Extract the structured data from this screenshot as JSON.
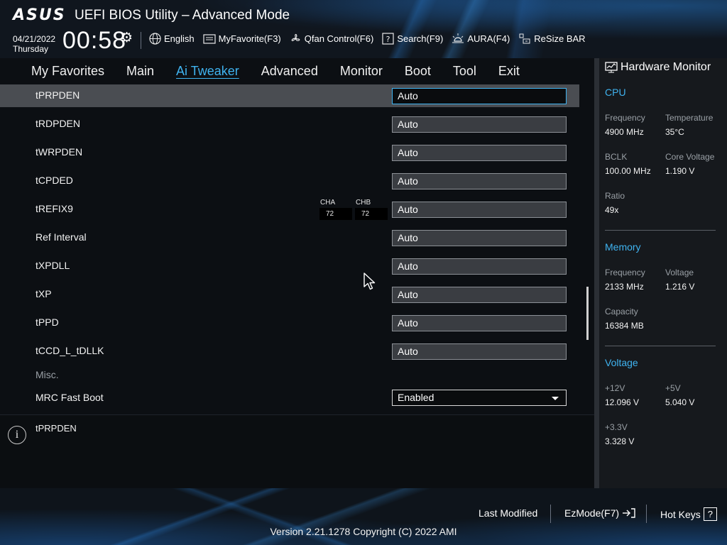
{
  "header": {
    "logo": "ASUS",
    "title": "UEFI BIOS Utility – Advanced Mode",
    "date": "04/21/2022",
    "day": "Thursday",
    "time": "00:58",
    "toolbar": [
      {
        "label": "English",
        "icon": "globe-icon"
      },
      {
        "label": "MyFavorite(F3)",
        "icon": "favorite-icon"
      },
      {
        "label": "Qfan Control(F6)",
        "icon": "fan-icon"
      },
      {
        "label": "Search(F9)",
        "icon": "search-icon"
      },
      {
        "label": "AURA(F4)",
        "icon": "aura-icon"
      },
      {
        "label": "ReSize BAR",
        "icon": "resize-bar-icon"
      }
    ]
  },
  "nav": {
    "tabs": [
      "My Favorites",
      "Main",
      "Ai Tweaker",
      "Advanced",
      "Monitor",
      "Boot",
      "Tool",
      "Exit"
    ],
    "active": "Ai Tweaker"
  },
  "settings": {
    "rows": [
      {
        "label": "tPRPDEN",
        "value": "Auto"
      },
      {
        "label": "tRDPDEN",
        "value": "Auto"
      },
      {
        "label": "tWRPDEN",
        "value": "Auto"
      },
      {
        "label": "tCPDED",
        "value": "Auto"
      },
      {
        "label": "tREFIX9",
        "value": "Auto"
      },
      {
        "label": "Ref Interval",
        "value": "Auto"
      },
      {
        "label": "tXPDLL",
        "value": "Auto"
      },
      {
        "label": "tXP",
        "value": "Auto"
      },
      {
        "label": "tPPD",
        "value": "Auto"
      },
      {
        "label": "tCCD_L_tDLLK",
        "value": "Auto"
      }
    ],
    "channels": [
      {
        "name": "CHA",
        "value": "72"
      },
      {
        "name": "CHB",
        "value": "72"
      }
    ],
    "section": "Misc.",
    "mrc_fast_boot": {
      "label": "MRC Fast Boot",
      "value": "Enabled"
    }
  },
  "help": {
    "text": "tPRPDEN"
  },
  "hardware_monitor": {
    "title": "Hardware Monitor",
    "cpu": {
      "title": "CPU",
      "frequency_label": "Frequency",
      "frequency": "4900 MHz",
      "temperature_label": "Temperature",
      "temperature": "35°C",
      "bclk_label": "BCLK",
      "bclk": "100.00 MHz",
      "core_voltage_label": "Core Voltage",
      "core_voltage": "1.190 V",
      "ratio_label": "Ratio",
      "ratio": "49x"
    },
    "memory": {
      "title": "Memory",
      "frequency_label": "Frequency",
      "frequency": "2133 MHz",
      "voltage_label": "Voltage",
      "voltage": "1.216 V",
      "capacity_label": "Capacity",
      "capacity": "16384 MB"
    },
    "voltage": {
      "title": "Voltage",
      "v12_label": "+12V",
      "v12": "12.096 V",
      "v5_label": "+5V",
      "v5": "5.040 V",
      "v33_label": "+3.3V",
      "v33": "3.328 V"
    }
  },
  "footer": {
    "last_modified": "Last Modified",
    "ezmode": "EzMode(F7)",
    "hotkeys": "Hot Keys",
    "hotkeys_key": "?",
    "version": "Version 2.21.1278 Copyright (C) 2022 AMI"
  },
  "colors": {
    "accent": "#3fb3f0",
    "selected_row": "#4a4d52",
    "panel": "#16191d"
  }
}
